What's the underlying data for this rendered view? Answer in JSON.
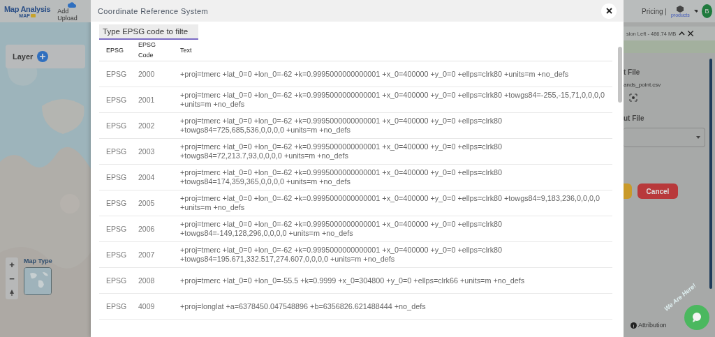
{
  "app": {
    "logo_title": "Map Analysis",
    "logo_subtitle": "MAP",
    "upload_label": "Add Upload",
    "layer_label": "Layer",
    "zoom_in": "+",
    "zoom_out": "−",
    "map_type_label": "Map Type",
    "pricing": "Pricing |",
    "products": "products",
    "avatar": "B",
    "storage": "sion Left - 486.74 MB",
    "input_file_heading": "t File",
    "file_name": "ands_point.csv",
    "output_file_heading": "ut File",
    "cancel": "Cancel",
    "attribution": "Attribution",
    "chat_badge": "We Are Here!"
  },
  "dialog": {
    "title": "Coordinate Reference System",
    "filter": {
      "placeholder": "Type EPSG code to filte"
    },
    "columns": [
      "EPSG",
      "EPSG Code",
      "Text"
    ],
    "rows": [
      {
        "epsg": "EPSG",
        "code": "2000",
        "text": "+proj=tmerc +lat_0=0 +lon_0=-62 +k=0.9995000000000001 +x_0=400000 +y_0=0 +ellps=clrk80 +units=m +no_defs"
      },
      {
        "epsg": "EPSG",
        "code": "2001",
        "text": "+proj=tmerc +lat_0=0 +lon_0=-62 +k=0.9995000000000001 +x_0=400000 +y_0=0 +ellps=clrk80 +towgs84=-255,-15,71,0,0,0,0 +units=m +no_defs"
      },
      {
        "epsg": "EPSG",
        "code": "2002",
        "text": "+proj=tmerc +lat_0=0 +lon_0=-62 +k=0.9995000000000001 +x_0=400000 +y_0=0 +ellps=clrk80 +towgs84=725,685,536,0,0,0,0 +units=m +no_defs"
      },
      {
        "epsg": "EPSG",
        "code": "2003",
        "text": "+proj=tmerc +lat_0=0 +lon_0=-62 +k=0.9995000000000001 +x_0=400000 +y_0=0 +ellps=clrk80 +towgs84=72,213.7,93,0,0,0,0 +units=m +no_defs"
      },
      {
        "epsg": "EPSG",
        "code": "2004",
        "text": "+proj=tmerc +lat_0=0 +lon_0=-62 +k=0.9995000000000001 +x_0=400000 +y_0=0 +ellps=clrk80 +towgs84=174,359,365,0,0,0,0 +units=m +no_defs"
      },
      {
        "epsg": "EPSG",
        "code": "2005",
        "text": "+proj=tmerc +lat_0=0 +lon_0=-62 +k=0.9995000000000001 +x_0=400000 +y_0=0 +ellps=clrk80 +towgs84=9,183,236,0,0,0,0 +units=m +no_defs"
      },
      {
        "epsg": "EPSG",
        "code": "2006",
        "text": "+proj=tmerc +lat_0=0 +lon_0=-62 +k=0.9995000000000001 +x_0=400000 +y_0=0 +ellps=clrk80 +towgs84=-149,128,296,0,0,0,0 +units=m +no_defs"
      },
      {
        "epsg": "EPSG",
        "code": "2007",
        "text": "+proj=tmerc +lat_0=0 +lon_0=-62 +k=0.9995000000000001 +x_0=400000 +y_0=0 +ellps=clrk80 +towgs84=195.671,332.517,274.607,0,0,0,0 +units=m +no_defs"
      },
      {
        "epsg": "EPSG",
        "code": "2008",
        "text": "+proj=tmerc +lat_0=0 +lon_0=-55.5 +k=0.9999 +x_0=304800 +y_0=0 +ellps=clrk66 +units=m +no_defs"
      },
      {
        "epsg": "EPSG",
        "code": "4009",
        "text": "+proj=longlat +a=6378450.047548896 +b=6356826.621488444 +no_defs"
      }
    ]
  }
}
